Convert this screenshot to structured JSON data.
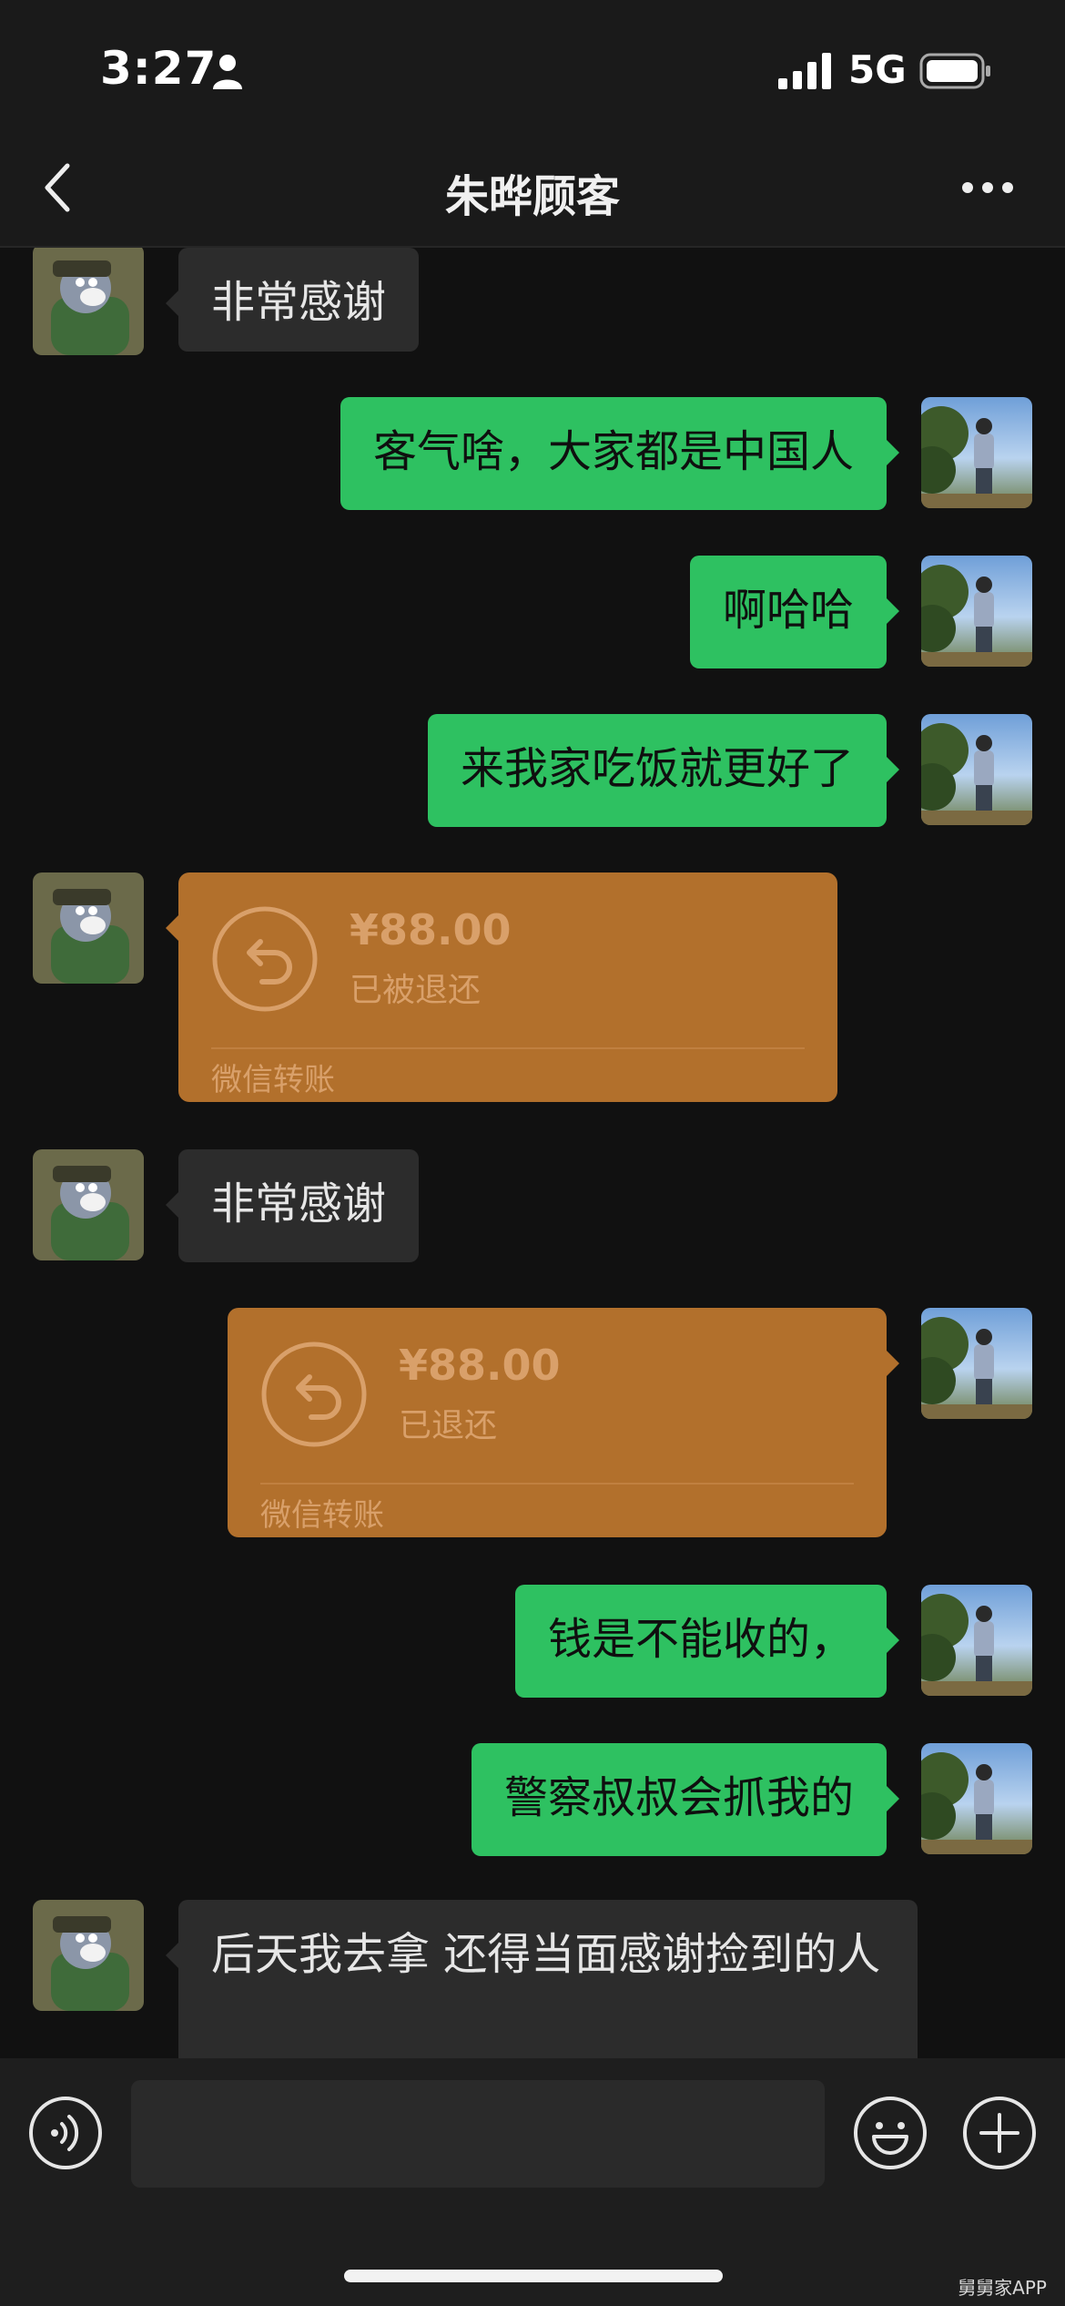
{
  "status_bar": {
    "time": "3:27",
    "network": "5G"
  },
  "nav": {
    "title": "朱晔顾客"
  },
  "messages": [
    {
      "side": "left",
      "type": "text",
      "text": "非常感谢"
    },
    {
      "side": "right",
      "type": "text",
      "text": "客气啥，大家都是中国人"
    },
    {
      "side": "right",
      "type": "text",
      "text": "啊哈哈"
    },
    {
      "side": "right",
      "type": "text",
      "text": "来我家吃饭就更好了"
    },
    {
      "side": "left",
      "type": "transfer",
      "amount": "¥88.00",
      "status": "已被退还",
      "label": "微信转账"
    },
    {
      "side": "left",
      "type": "text",
      "text": "非常感谢"
    },
    {
      "side": "right",
      "type": "transfer",
      "amount": "¥88.00",
      "status": "已退还",
      "label": "微信转账"
    },
    {
      "side": "right",
      "type": "text",
      "text": "钱是不能收的，"
    },
    {
      "side": "right",
      "type": "text",
      "text": "警察叔叔会抓我的"
    },
    {
      "side": "left",
      "type": "text",
      "text": "后天我去拿 还得当面感谢捡到的人"
    }
  ],
  "input_bar": {
    "placeholder": ""
  },
  "watermark": "舅舅家APP",
  "colors": {
    "background": "#111111",
    "bubble_sent": "#2ec161",
    "bubble_received": "#2c2c2c",
    "transfer_refunded": "#b2702c"
  }
}
